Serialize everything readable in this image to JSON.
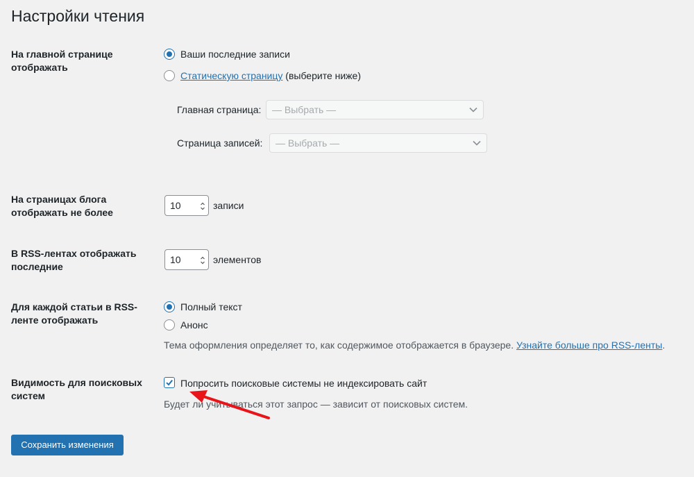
{
  "page": {
    "title": "Настройки чтения"
  },
  "front_page": {
    "label": "На главной странице отображать",
    "option_latest": "Ваши последние записи",
    "option_static_link": "Статическую страницу",
    "option_static_suffix": "(выберите ниже)",
    "selected": "latest",
    "homepage_label": "Главная страница:",
    "homepage_value": "— Выбрать —",
    "postspage_label": "Страница записей:",
    "postspage_value": "— Выбрать —"
  },
  "blog_pages": {
    "label": "На страницах блога отображать не более",
    "value": "10",
    "unit": "записи"
  },
  "rss_items": {
    "label": "В RSS-лентах отображать последние",
    "value": "10",
    "unit": "элементов"
  },
  "rss_content": {
    "label": "Для каждой статьи в RSS-ленте отображать",
    "option_full": "Полный текст",
    "option_summary": "Анонс",
    "selected": "full",
    "note_text": "Тема оформления определяет то, как содержимое отображается в браузере.",
    "note_link": "Узнайте больше про RSS-ленты",
    "note_end": "."
  },
  "search_visibility": {
    "label": "Видимость для поисковых систем",
    "checkbox_label": "Попросить поисковые системы не индексировать сайт",
    "checked": true,
    "note_before": "Будет ли учитываться этот запрос — зависит от поисковых систем."
  },
  "actions": {
    "save_label": "Сохранить изменения"
  },
  "colors": {
    "accent": "#2271b1",
    "background": "#f1f1f1",
    "annotation_arrow": "#e8141a"
  }
}
